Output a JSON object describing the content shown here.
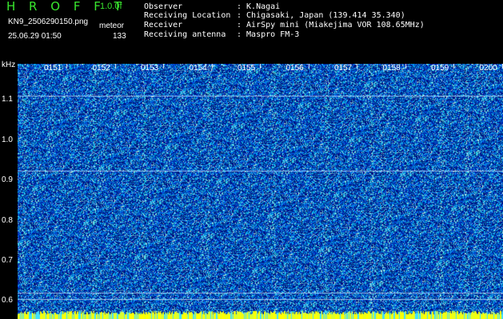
{
  "app": {
    "title": "H R O F F T",
    "version": "1.0.0f",
    "filename": "KN9_2506290150.png",
    "mode": "meteor",
    "timestamp": "25.06.29 01:50",
    "count": "133"
  },
  "info": {
    "rows": [
      {
        "label": "Observer",
        "value": ": K.Nagai"
      },
      {
        "label": "Receiving Location",
        "value": ": Chigasaki, Japan (139.414 35.340)"
      },
      {
        "label": "Receiver",
        "value": ": AirSpy mini (Miakejima VOR 108.65MHz)"
      },
      {
        "label": "Receiving antenna",
        "value": ": Maspro FM-3"
      }
    ]
  },
  "chart_data": {
    "type": "heatmap",
    "ylabel": "kHz",
    "yticks": [
      "1.1",
      "1.0",
      "0.9",
      "0.8",
      "0.7",
      "0.6"
    ],
    "ytick_values": [
      1.1,
      1.0,
      0.9,
      0.8,
      0.7,
      0.6
    ],
    "ylim": [
      0.575,
      1.19
    ],
    "xticks": [
      "0151",
      "0152",
      "0153",
      "0154",
      "0155",
      "0156",
      "0157",
      "0158",
      "0159",
      "0200"
    ],
    "horizontal_lines_khz": [
      1.11,
      0.925,
      0.62,
      0.605
    ],
    "colors": {
      "background": "#000090",
      "noise_low": "#0044ff",
      "noise_high": "#00ffd0",
      "bottom_band": "#ffff00",
      "grid_line": "#c8e0ff"
    }
  }
}
